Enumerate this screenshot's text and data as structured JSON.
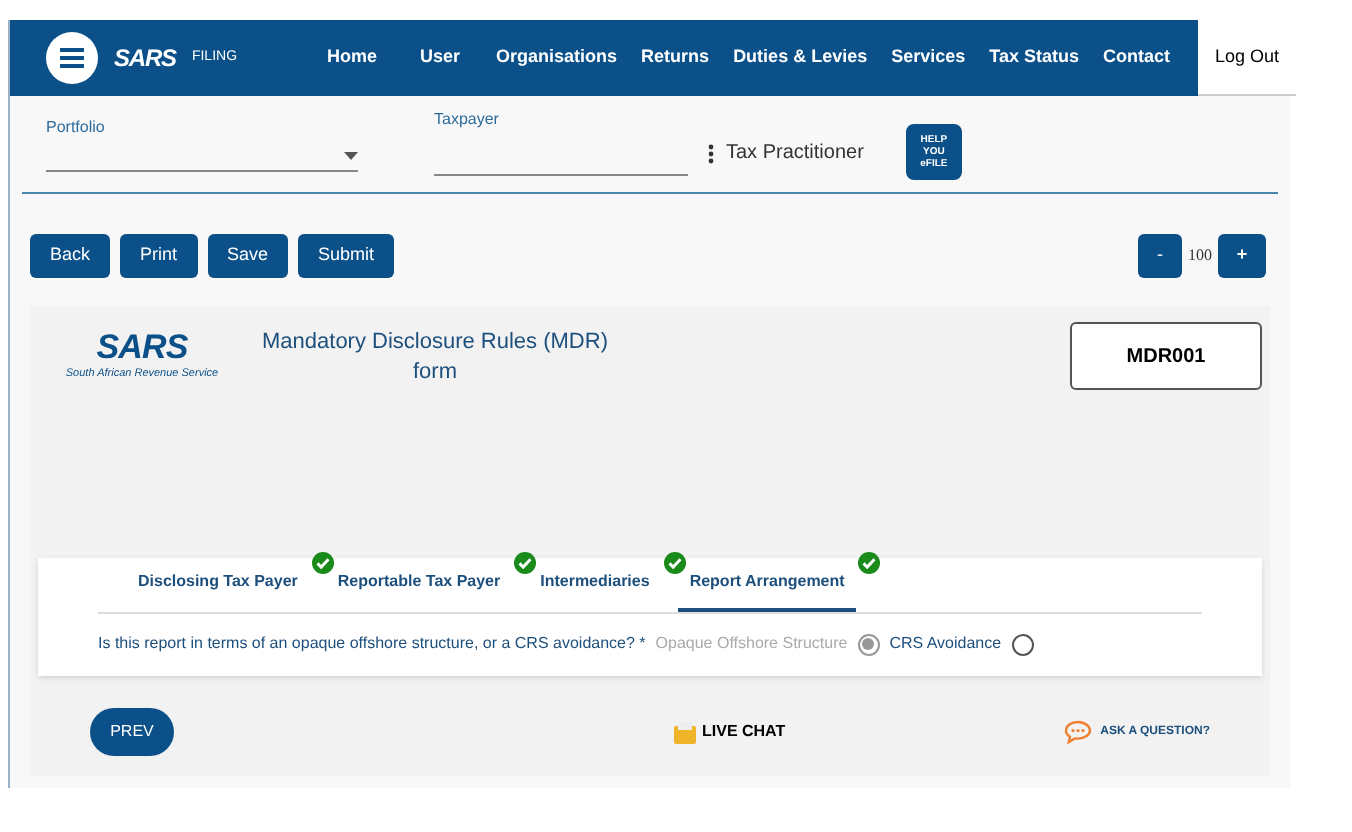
{
  "nav": {
    "brand": "SARS",
    "filing": "FILING",
    "items": [
      {
        "label": "Home"
      },
      {
        "label": "User"
      },
      {
        "label": "Organisations"
      },
      {
        "label": "Returns"
      },
      {
        "label": "Duties & Levies"
      },
      {
        "label": "Services"
      },
      {
        "label": "Tax Status"
      },
      {
        "label": "Contact"
      }
    ],
    "logout": "Log Out"
  },
  "selectors": {
    "portfolio": {
      "label": "Portfolio"
    },
    "taxpayer": {
      "label": "Taxpayer"
    },
    "role": "Tax Practitioner",
    "help_badge": [
      "HELP",
      "YOU",
      "eFILE"
    ]
  },
  "toolbar": {
    "buttons": [
      "Back",
      "Print",
      "Save",
      "Submit"
    ],
    "zoom_minus": "-",
    "zoom_value": "100",
    "zoom_plus": "+"
  },
  "form_header": {
    "logo": "SARS",
    "logo_caption": "South African Revenue Service",
    "title_line1": "Mandatory Disclosure Rules (MDR)",
    "title_line2": "form",
    "form_code": "MDR001"
  },
  "tabs": [
    {
      "label": "Disclosing Tax Payer",
      "selected": false,
      "complete": true
    },
    {
      "label": "Reportable Tax Payer",
      "selected": false,
      "complete": true
    },
    {
      "label": "Intermediaries",
      "selected": false,
      "complete": true
    },
    {
      "label": "Report Arrangement",
      "selected": true,
      "complete": true
    }
  ],
  "question": {
    "text": "Is this report in terms of an opaque offshore structure, or a CRS avoidance? *",
    "options": [
      {
        "label": "Opaque Offshore Structure",
        "selected": true,
        "disabled": true
      },
      {
        "label": "CRS Avoidance",
        "selected": false,
        "disabled": false
      }
    ]
  },
  "footer": {
    "prev": "PREV",
    "live_chat": "LIVE CHAT",
    "ask": "ASK A QUESTION?"
  }
}
